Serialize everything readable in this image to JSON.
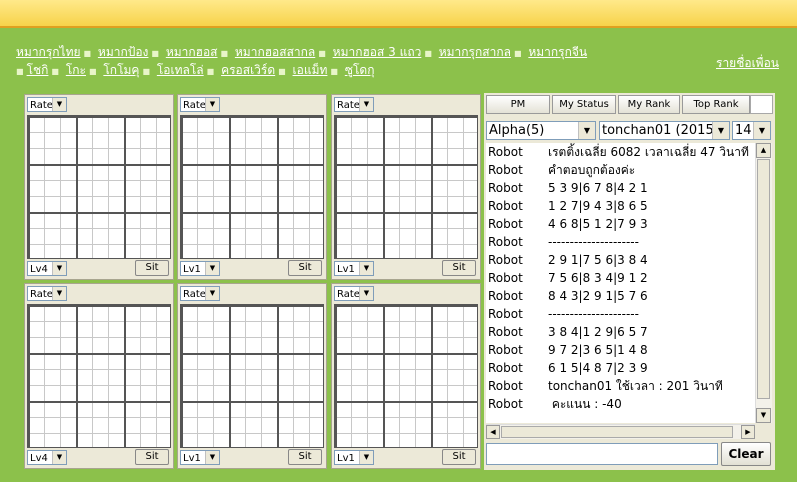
{
  "nav": {
    "links_row1": [
      "หมากรุกไทย",
      "หมากป้อง",
      "หมากฮอส",
      "หมากฮอสสากล",
      "หมากฮอส 3 แถว",
      "หมากรุกสากล",
      "หมากรุกจีน"
    ],
    "links_row2": [
      "โชกิ",
      "โกะ",
      "โกโมคุ",
      "โอเทลโล่",
      "ครอสเวิร์ด",
      "เอแม็ท",
      "ซูโดกุ"
    ],
    "friends_link": "รายชื่อเพื่อน"
  },
  "boards": [
    {
      "rate": "Rate",
      "level": "Lv4",
      "sit": "Sit"
    },
    {
      "rate": "Rate",
      "level": "Lv1",
      "sit": "Sit"
    },
    {
      "rate": "Rate",
      "level": "Lv1",
      "sit": "Sit"
    },
    {
      "rate": "Rate",
      "level": "Lv4",
      "sit": "Sit"
    },
    {
      "rate": "Rate",
      "level": "Lv1",
      "sit": "Sit"
    },
    {
      "rate": "Rate",
      "level": "Lv1",
      "sit": "Sit"
    }
  ],
  "chat": {
    "tabs": [
      "PM",
      "My Status",
      "My Rank",
      "Top Rank"
    ],
    "room_select": "Alpha(5)",
    "user_select": "tonchan01 (2015",
    "size_select": "14",
    "messages": [
      {
        "who": "Robot",
        "text": "เรตติ้งเฉลี่ย 6082 เวลาเฉลี่ย 47 วินาที"
      },
      {
        "who": "Robot",
        "text": "คำตอบถูกต้องค่ะ"
      },
      {
        "who": "Robot",
        "text": "5 3 9|6 7 8|4 2 1"
      },
      {
        "who": "Robot",
        "text": "1 2 7|9 4 3|8 6 5"
      },
      {
        "who": "Robot",
        "text": "4 6 8|5 1 2|7 9 3"
      },
      {
        "who": "Robot",
        "text": "---------------------"
      },
      {
        "who": "Robot",
        "text": "2 9 1|7 5 6|3 8 4"
      },
      {
        "who": "Robot",
        "text": "7 5 6|8 3 4|9 1 2"
      },
      {
        "who": "Robot",
        "text": "8 4 3|2 9 1|5 7 6"
      },
      {
        "who": "Robot",
        "text": "---------------------"
      },
      {
        "who": "Robot",
        "text": "3 8 4|1 2 9|6 5 7"
      },
      {
        "who": "Robot",
        "text": "9 7 2|3 6 5|1 4 8"
      },
      {
        "who": "Robot",
        "text": "6 1 5|4 8 7|2 3 9"
      },
      {
        "who": "Robot",
        "text": "tonchan01 ใช้เวลา : 201 วินาที"
      },
      {
        "who": "Robot",
        "text": " คะแนน : -40"
      }
    ],
    "input_value": "",
    "clear_label": "Clear"
  }
}
